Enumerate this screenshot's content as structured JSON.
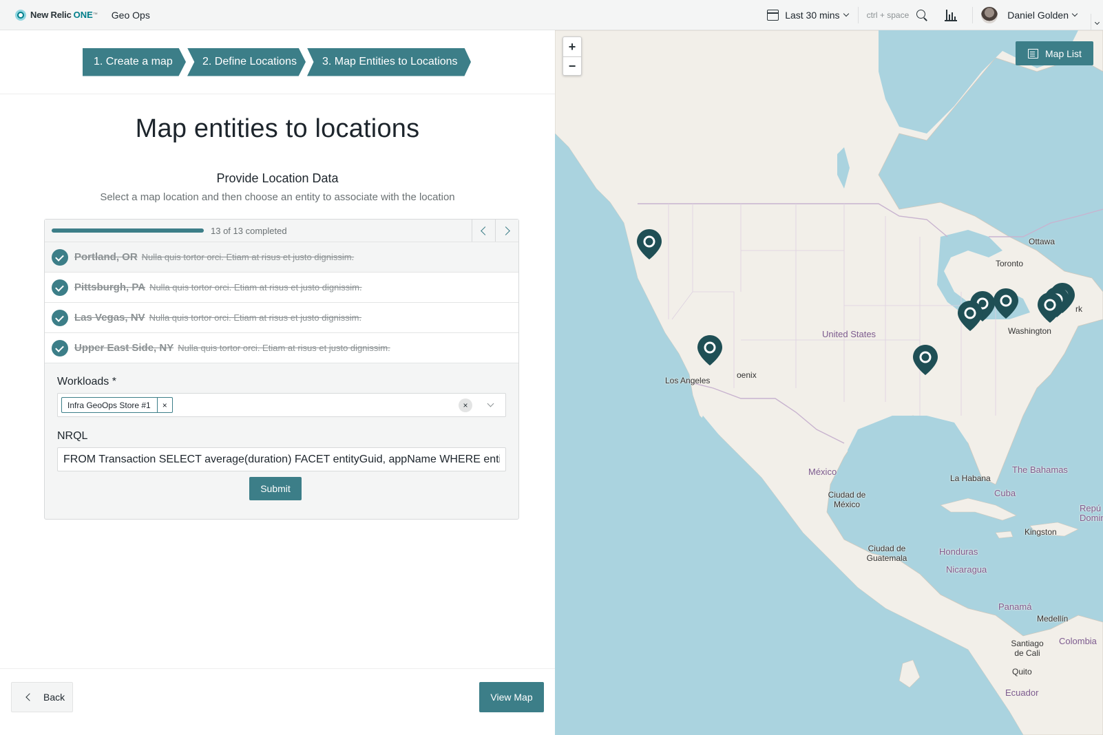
{
  "header": {
    "brand": "New Relic",
    "brand_one": "ONE",
    "brand_tm": "™",
    "app_name": "Geo Ops",
    "time_range": "Last 30 mins",
    "shortcut_hint": "ctrl + space",
    "user_name": "Daniel Golden"
  },
  "stepper": {
    "steps": [
      {
        "label": "1. Create a map"
      },
      {
        "label": "2. Define Locations"
      },
      {
        "label": "3. Map Entities to Locations"
      }
    ]
  },
  "page": {
    "title": "Map entities to locations",
    "section_title": "Provide Location Data",
    "section_subtitle": "Select a map location and then choose an entity to associate with the location"
  },
  "progress": {
    "text": "13 of 13 completed",
    "completed": 13,
    "total": 13,
    "fraction": 1.0
  },
  "locations": [
    {
      "name": "Portland, OR",
      "description": "Nulla quis tortor orci. Etiam at risus et justo dignissim."
    },
    {
      "name": "Pittsburgh, PA",
      "description": "Nulla quis tortor orci. Etiam at risus et justo dignissim."
    },
    {
      "name": "Las Vegas, NV",
      "description": "Nulla quis tortor orci. Etiam at risus et justo dignissim."
    },
    {
      "name": "Upper East Side, NY",
      "description": "Nulla quis tortor orci. Etiam at risus et justo dignissim."
    }
  ],
  "form": {
    "workloads_label": "Workloads *",
    "workload_chip": "Infra GeoOps Store #1",
    "chip_remove": "×",
    "clear_symbol": "×",
    "nrql_label": "NRQL",
    "nrql_value": "FROM Transaction SELECT average(duration) FACET entityGuid, appName WHERE entityGuid",
    "submit_label": "Submit"
  },
  "footer": {
    "back_label": "Back",
    "view_map_label": "View Map"
  },
  "map": {
    "zoom_in": "+",
    "zoom_out": "−",
    "map_list_label": "Map List",
    "labels": {
      "ottawa": "Ottawa",
      "toronto": "Toronto",
      "washington": "Washington",
      "united_states": "United States",
      "los_angeles": "Los Angeles",
      "phoenix": "oenix",
      "mexico": "México",
      "ciudad_de_mexico": "Ciudad de México",
      "la_habana": "La Habana",
      "the_bahamas": "The Bahamas",
      "cuba": "Cuba",
      "kingston": "Kingston",
      "republica_dominicana": "Repú Domin",
      "ciudad_de_guatemala": "Ciudad de Guatemala",
      "honduras": "Honduras",
      "nicaragua": "Nicaragua",
      "panama": "Panamá",
      "medellin": "Medellín",
      "colombia": "Colombia",
      "santiago_de_cali": "Santiago de Cali",
      "quito": "Quito",
      "ecuador": "Ecuador",
      "new_york_partial": "rk"
    },
    "colors": {
      "water": "#aad3df",
      "land": "#f2efe9",
      "pin": "#1f4f55",
      "accent": "#3c7e88"
    }
  }
}
